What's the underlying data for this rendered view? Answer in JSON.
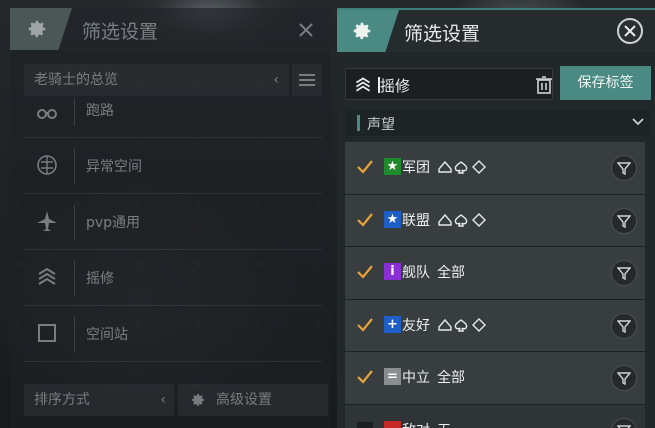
{
  "left_panel": {
    "title": "筛选设置",
    "overview": "老骑士的总览",
    "items": [
      {
        "label": "跑路",
        "icon": "binoculars-icon"
      },
      {
        "label": "异常空间",
        "icon": "anomaly-icon"
      },
      {
        "label": "pvp通用",
        "icon": "fighter-icon"
      },
      {
        "label": "摇修",
        "icon": "chevrons-icon"
      },
      {
        "label": "空间站",
        "icon": "square-icon"
      }
    ],
    "sort_label": "排序方式",
    "advanced_label": "高级设置"
  },
  "right_panel": {
    "title": "筛选设置",
    "search_value": "摇修",
    "save_label": "保存标签",
    "section_label": "声望",
    "rows": [
      {
        "name": "军团",
        "extra": "",
        "shapes": true,
        "standing_color": "#1f8a2b",
        "standing_glyph": "★",
        "checked": true
      },
      {
        "name": "联盟",
        "extra": "",
        "shapes": true,
        "standing_color": "#1d5fc6",
        "standing_glyph": "★",
        "checked": true
      },
      {
        "name": "舰队",
        "extra": "全部",
        "shapes": false,
        "standing_color": "#8a2fd3",
        "standing_glyph": "i",
        "checked": true
      },
      {
        "name": "友好",
        "extra": "",
        "shapes": true,
        "standing_color": "#1d5fc6",
        "standing_glyph": "+",
        "checked": true
      },
      {
        "name": "中立",
        "extra": "全部",
        "shapes": false,
        "standing_color": "#8a8d90",
        "standing_glyph": "=",
        "checked": true
      },
      {
        "name": "敌对",
        "extra": "无",
        "shapes": false,
        "standing_color": "#c62828",
        "standing_glyph": "−",
        "checked": false
      }
    ]
  },
  "colors": {
    "accent": "#4b8a83",
    "check": "#e8a33a"
  }
}
